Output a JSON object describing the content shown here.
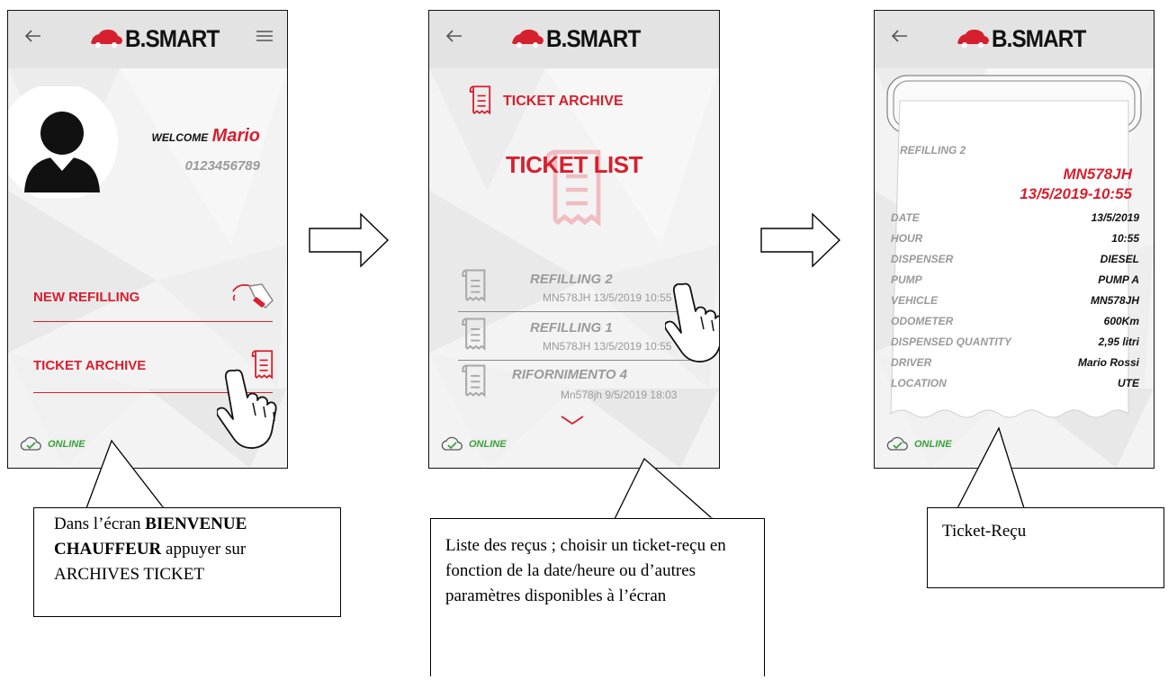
{
  "screen1": {
    "logo": "B.SMART",
    "welcome_label": "WELCOME",
    "user_name": "Mario",
    "user_phone": "0123456789",
    "menu": [
      {
        "label": "NEW REFILLING",
        "icon": "fuel-nozzle-icon"
      },
      {
        "label": "TICKET ARCHIVE",
        "icon": "receipt-icon"
      }
    ],
    "status": "ONLINE"
  },
  "screen2": {
    "logo": "B.SMART",
    "header": "TICKET ARCHIVE",
    "list_title": "TICKET LIST",
    "tickets": [
      {
        "title": "REFILLING 2",
        "detail": "MN578JH 13/5/2019 10:55"
      },
      {
        "title": "REFILLING 1",
        "detail": "MN578JH 13/5/2019 10:55"
      },
      {
        "title": "RIFORNIMENTO 4",
        "detail": "Mn578jh 9/5/2019 18:03"
      }
    ],
    "status": "ONLINE"
  },
  "screen3": {
    "logo": "B.SMART",
    "ticket_title": "REFILLING 2",
    "plate": "MN578JH",
    "datetime": "13/5/2019-10:55",
    "fields": [
      {
        "key": "DATE",
        "value": "13/5/2019"
      },
      {
        "key": "HOUR",
        "value": "10:55"
      },
      {
        "key": "DISPENSER",
        "value": "DIESEL"
      },
      {
        "key": "PUMP",
        "value": "PUMP A"
      },
      {
        "key": "VEHICLE",
        "value": "MN578JH"
      },
      {
        "key": "ODOMETER",
        "value": "600Km"
      },
      {
        "key": "DISPENSED QUANTITY",
        "value": "2,95 litri"
      },
      {
        "key": "DRIVER",
        "value": "Mario Rossi"
      },
      {
        "key": "LOCATION",
        "value": "UTE"
      }
    ],
    "status": "ONLINE"
  },
  "callouts": {
    "c1_part1": "Dans l’écran ",
    "c1_bold1": "BIENVENUE CHAUFFEUR",
    "c1_part2": " appuyer sur ARCHIVES TICKET",
    "c2": "Liste des reçus ; choisir un ticket-reçu en fonction de la date/heure ou d’autres paramètres disponibles à l’écran",
    "c3": "Ticket-Reçu"
  },
  "colors": {
    "accent": "#d6202f",
    "online": "#3ba03b",
    "topbar": "#e3e3e3"
  }
}
